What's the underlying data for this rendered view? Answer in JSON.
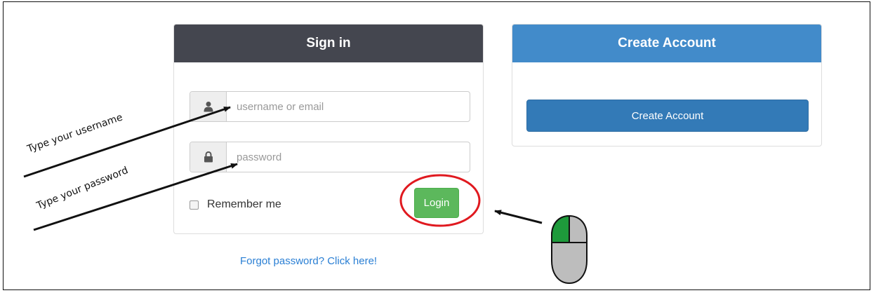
{
  "signin": {
    "title": "Sign in",
    "username_placeholder": "username or email",
    "password_placeholder": "password",
    "remember_label": "Remember me",
    "login_label": "Login"
  },
  "create": {
    "title": "Create Account",
    "button_label": "Create Account"
  },
  "forgot_link": "Forgot password? Click here!",
  "annotations": {
    "username_hint": "Type your username",
    "password_hint": "Type your password"
  },
  "icons": {
    "username": "user-icon",
    "password": "lock-icon",
    "mouse": "mouse-icon"
  },
  "colors": {
    "signin_header": "#44464f",
    "create_header": "#428bca",
    "login_button": "#5cb85c",
    "create_button": "#337ab7",
    "highlight_circle": "#e0191f",
    "mouse_left_button": "#1e9a3b",
    "link": "#2a7fd4"
  }
}
